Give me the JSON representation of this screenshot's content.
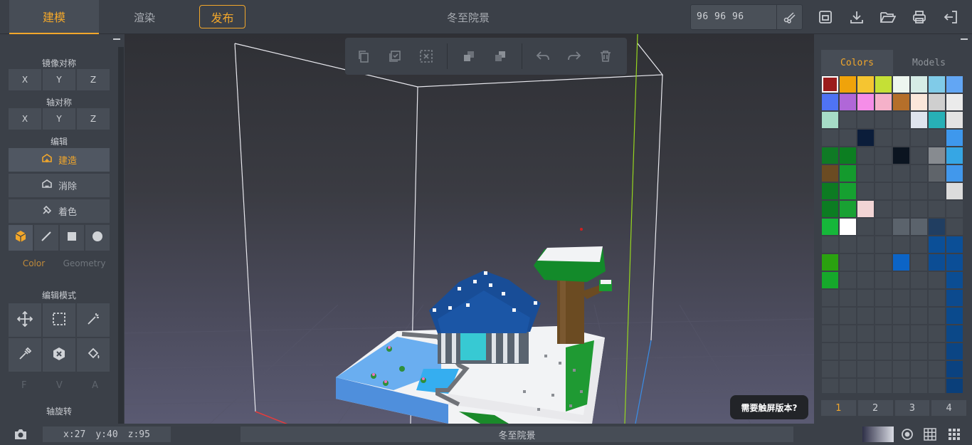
{
  "header": {
    "tabs": [
      {
        "label": "建模",
        "active": true
      },
      {
        "label": "渲染",
        "active": false
      }
    ],
    "publish_label": "发布",
    "title": "冬至院景",
    "size_value": "96 96 96",
    "icons": [
      "scissors-icon",
      "save-icon",
      "download-icon",
      "open-folder-icon",
      "print-icon",
      "exit-icon"
    ]
  },
  "left_panel": {
    "mirror_label": "镜像对称",
    "mirror_axes": [
      "X",
      "Y",
      "Z"
    ],
    "axis_sym_label": "轴对称",
    "axis_sym_axes": [
      "X",
      "Y",
      "Z"
    ],
    "edit_label": "编辑",
    "edit_tools": [
      {
        "label": "建造",
        "icon": "build-icon",
        "active": true
      },
      {
        "label": "消除",
        "icon": "erase-icon",
        "active": false
      },
      {
        "label": "着色",
        "icon": "paint-icon",
        "active": false
      }
    ],
    "mode_tabs": [
      {
        "label": "Color",
        "active": true
      },
      {
        "label": "Geometry",
        "active": false
      }
    ],
    "edit_mode_label": "编辑模式",
    "fva": [
      "F",
      "V",
      "A"
    ],
    "rotate_label": "轴旋转"
  },
  "colors": {
    "accent": "#f2a72b",
    "panel": "#3b4048"
  },
  "right_panel": {
    "tabs": [
      {
        "label": "Colors",
        "active": true
      },
      {
        "label": "Models",
        "active": false
      }
    ],
    "pages": [
      "1",
      "2",
      "3",
      "4"
    ],
    "palette": [
      "#9b1c1c",
      "#f0a30a",
      "#f5c531",
      "#c5e036",
      "#edf6ef",
      "#d6ece6",
      "#80cbe8",
      "#62a6f4",
      "#4f73f4",
      "#b067d8",
      "#f58de8",
      "#f5b1c9",
      "#b56f2a",
      "#fbe7da",
      "#cfcfcf",
      "#ebebeb",
      "#a6dcc7",
      "",
      "",
      "",
      "",
      "#dfe4ee",
      "#27b0b6",
      "#e3e3e3",
      "",
      "",
      "#0b1d3a",
      "",
      "",
      "",
      "",
      "#3e98ed",
      "#0f7a25",
      "#0c7e21",
      "",
      "",
      "#0b1420",
      "",
      "#878b90",
      "#36a6e4",
      "#6b4b22",
      "#149a2d",
      "",
      "",
      "",
      "",
      "#5f646a",
      "#4198ec",
      "#0d7b22",
      "#16a030",
      "",
      "",
      "",
      "",
      "",
      "#dcdcdc",
      "#0c7c22",
      "#19a133",
      "#f2d5d5",
      "",
      "",
      "",
      "",
      "",
      "#16b73a",
      "#ffffff",
      "",
      "",
      "#5b636c",
      "#5b636c",
      "#213e61",
      "",
      "",
      "",
      "",
      "",
      "",
      "",
      "#0b4f97",
      "#0b4f97",
      "#2aa20f",
      "",
      "",
      "",
      "#0c64c6",
      "",
      "#0c4d94",
      "#0b4e97",
      "#16a82b",
      "",
      "",
      "",
      "",
      "",
      "",
      "#0b4d93",
      "",
      "",
      "",
      "",
      "",
      "",
      "",
      "#0c4a8e",
      "",
      "",
      "",
      "",
      "",
      "",
      "",
      "#0a4a8d",
      "",
      "",
      "",
      "",
      "",
      "",
      "",
      "#0b4888",
      "",
      "",
      "",
      "",
      "",
      "",
      "",
      "#0b4584",
      "",
      "",
      "",
      "",
      "",
      "",
      "",
      "#0b4280",
      "",
      "",
      "",
      "",
      "",
      "",
      "",
      "#0a3f7a"
    ]
  },
  "viewport": {
    "toolbar_icons": [
      "copy-icon",
      "select-all-icon",
      "deselect-icon",
      "group-icon",
      "ungroup-icon",
      "undo-icon",
      "redo-icon",
      "delete-icon"
    ],
    "tooltip": "需要触屏版本?"
  },
  "status": {
    "x": "x:27",
    "y": "y:40",
    "z": "z:95",
    "title": "冬至院景"
  }
}
